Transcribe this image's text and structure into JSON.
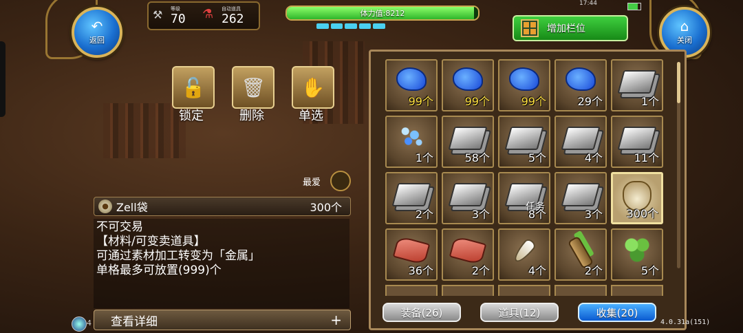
{
  "top": {
    "back_label": "返回",
    "close_label": "关闭",
    "level_label": "等级",
    "level_value": "70",
    "auto_items_label": "自动道具",
    "auto_items_value": "262",
    "stamina_label": "体力值:8212",
    "stamina_fraction": 0.98,
    "time": "17:44",
    "add_slot_label": "增加栏位"
  },
  "actions": {
    "lock_label": "锁定",
    "delete_label": "删除",
    "single_select_label": "单选"
  },
  "favorite_label": "最爱",
  "detail": {
    "item_name": "Zell袋",
    "item_count": "300个",
    "lines": [
      "不可交易",
      "【材料/可变卖道具】",
      "可通过素材加工转变为「金属」",
      "单格最多可放置(999)个"
    ],
    "view_details_label": "查看详细",
    "plus": "+",
    "corner_num": "4"
  },
  "inventory": {
    "items": [
      {
        "icon": "blue-stone-icon",
        "qty": "99个",
        "gold": true
      },
      {
        "icon": "blue-stone-icon",
        "qty": "99个",
        "gold": true
      },
      {
        "icon": "blue-stone-icon",
        "qty": "99个",
        "gold": true
      },
      {
        "icon": "blue-stone-icon",
        "qty": "29个",
        "gold": false
      },
      {
        "icon": "silver-ingot-icon",
        "qty": "1个",
        "gold": false
      },
      {
        "icon": "blue-shards-icon",
        "qty": "1个",
        "gold": false
      },
      {
        "icon": "silver-ingot-icon",
        "qty": "58个",
        "gold": false
      },
      {
        "icon": "silver-ingot-icon",
        "qty": "5个",
        "gold": false
      },
      {
        "icon": "silver-ingot-icon",
        "qty": "4个",
        "gold": false
      },
      {
        "icon": "silver-ingot-icon",
        "qty": "11个",
        "gold": false
      },
      {
        "icon": "silver-ingot-icon",
        "qty": "2个",
        "gold": false
      },
      {
        "icon": "silver-ingot-icon",
        "qty": "3个",
        "gold": false
      },
      {
        "icon": "silver-ingot-icon",
        "qty": "8个",
        "gold": false,
        "mark": "任务"
      },
      {
        "icon": "silver-ingot-icon",
        "qty": "3个",
        "gold": false
      },
      {
        "icon": "zell-bag-icon",
        "qty": "300个",
        "gold": false,
        "selected": true
      },
      {
        "icon": "red-cloth-icon",
        "qty": "36个",
        "gold": false
      },
      {
        "icon": "red-cloth-icon",
        "qty": "2个",
        "gold": false
      },
      {
        "icon": "fang-icon",
        "qty": "4个",
        "gold": false
      },
      {
        "icon": "branch-icon",
        "qty": "2个",
        "gold": false
      },
      {
        "icon": "herb-leaf-icon",
        "qty": "5个",
        "gold": false
      }
    ],
    "tabs": [
      {
        "label": "装备(26)",
        "active": false
      },
      {
        "label": "道具(12)",
        "active": false
      },
      {
        "label": "收集(20)",
        "active": true
      }
    ],
    "version": "4.0.31a(151)"
  }
}
